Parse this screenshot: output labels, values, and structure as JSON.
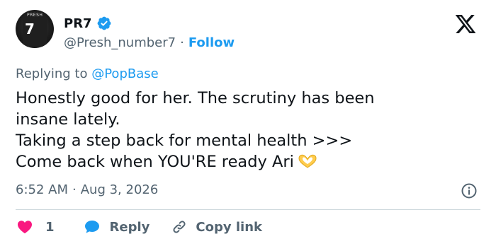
{
  "author": {
    "display_name": "PR7",
    "handle": "@Presh_number7",
    "separator": "·",
    "follow_label": "Follow",
    "avatar_jersey_number": "7",
    "avatar_jersey_tag": "PRESH",
    "verified_color": "#1d9bf0"
  },
  "reply_context": {
    "prefix": "Replying to",
    "mention": "@PopBase"
  },
  "tweet": {
    "lines": [
      "Honestly good for her. The scrutiny has been",
      "insane lately.",
      "Taking a step back for mental health >>>",
      "Come back when YOU'RE ready Ari"
    ],
    "emoji": "heart-hands-emoji"
  },
  "meta": {
    "time": "6:52 AM",
    "separator": "·",
    "date": "Aug 3, 2026"
  },
  "actions": {
    "like_count": "1",
    "reply_label": "Reply",
    "copy_link_label": "Copy link"
  },
  "colors": {
    "accent": "#1d9bf0",
    "like": "#f91880",
    "secondary_text": "#536471",
    "divider": "#cfd9de"
  },
  "icons": [
    "x-logo-icon",
    "verified-badge-icon",
    "info-icon",
    "heart-icon",
    "reply-bubble-icon",
    "link-icon"
  ]
}
